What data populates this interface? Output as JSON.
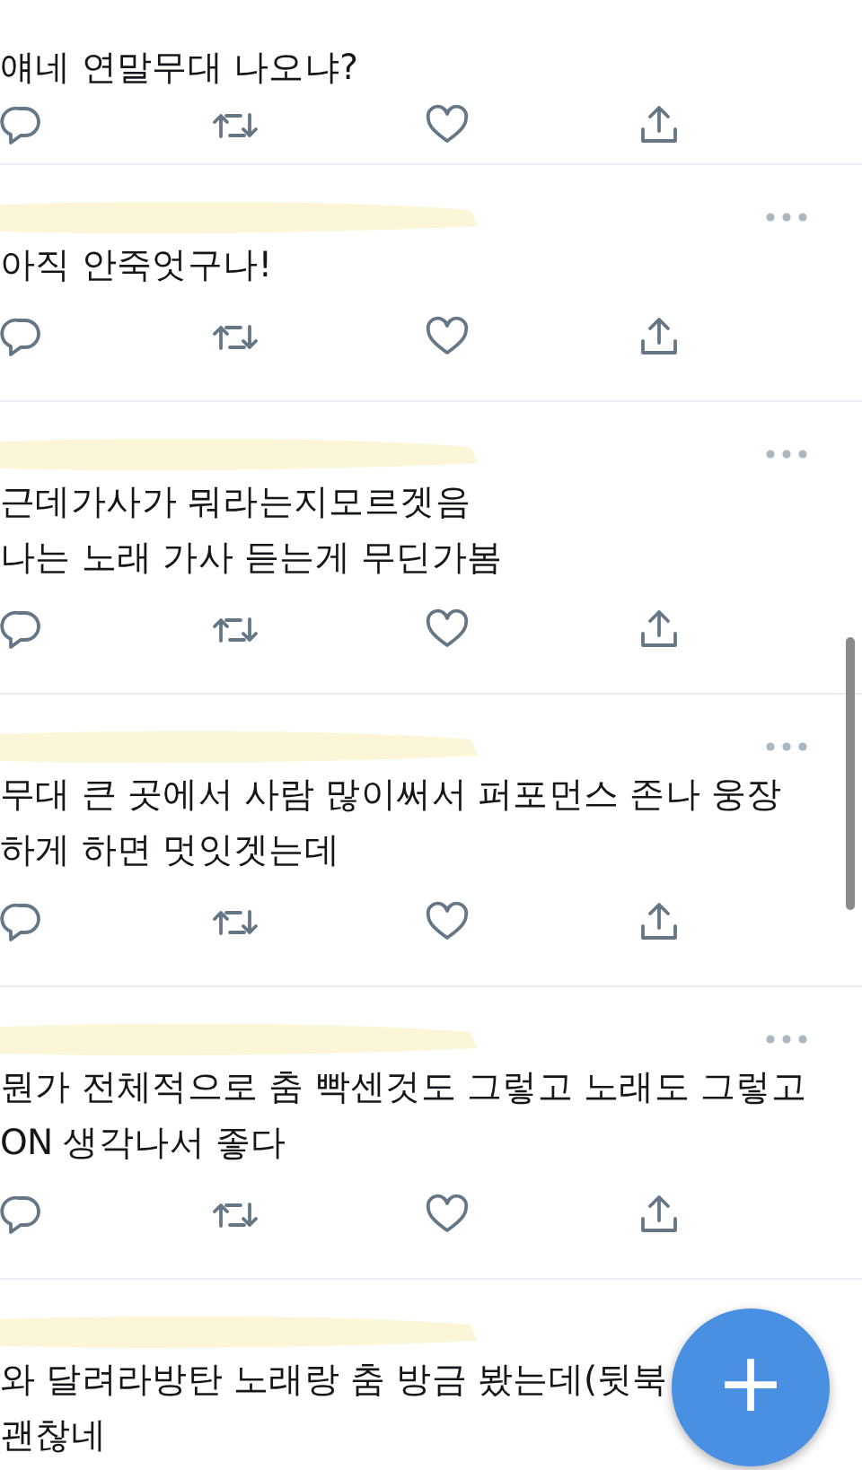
{
  "tweets": [
    {
      "header_redacted": false,
      "menu": false,
      "text": [
        "얘네 연말무대 나오냐?"
      ],
      "actions": true
    },
    {
      "header_redacted": true,
      "menu": true,
      "text": [
        "아직 안죽엇구나!"
      ],
      "actions": true
    },
    {
      "header_redacted": true,
      "menu": true,
      "text": [
        "근데가사가 뭐라는지모르겟음",
        "나는 노래 가사 듣는게 무딘가봄"
      ],
      "actions": true
    },
    {
      "header_redacted": true,
      "menu": true,
      "text": [
        "무대 큰 곳에서 사람 많이써서 퍼포먼스 존나 웅장",
        "하게 하면 멋잇겟는데"
      ],
      "actions": true
    },
    {
      "header_redacted": true,
      "menu": true,
      "text": [
        "뭔가 전체적으로 춤 빡센것도 그렇고 노래도 그렇고",
        "ON 생각나서 좋다"
      ],
      "actions": true
    },
    {
      "header_redacted": true,
      "menu": false,
      "text": [
        "와 달려라방탄 노래랑 춤 방금 봤는데(뒷북",
        "괜찮네"
      ],
      "actions": false
    }
  ],
  "compose_button": {
    "label": "+"
  }
}
